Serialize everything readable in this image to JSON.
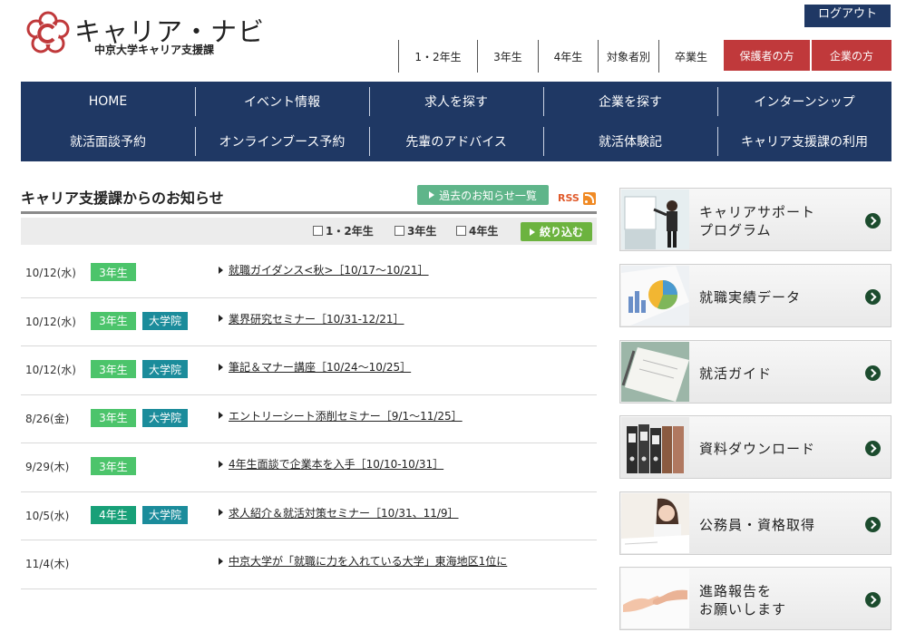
{
  "header": {
    "logo_title": "キャリア・ナビ",
    "logo_sub": "中京大学キャリア支援課",
    "logout_label": "ログアウト",
    "grade_nav": [
      "1・2年生",
      "3年生",
      "4年生",
      "対象者別",
      "卒業生"
    ],
    "role_buttons": [
      "保護者の方",
      "企業の方"
    ]
  },
  "mainnav": {
    "row1": [
      "HOME",
      "イベント情報",
      "求人を探す",
      "企業を探す",
      "インターンシップ"
    ],
    "row2": [
      "就活面談予約",
      "オンラインブース予約",
      "先輩のアドバイス",
      "就活体験記",
      "キャリア支援課の利用"
    ]
  },
  "news": {
    "title": "キャリア支援課からのお知らせ",
    "past_label": "過去のお知らせ一覧",
    "rss_label": "RSS",
    "filters": [
      "1・2年生",
      "3年生",
      "4年生"
    ],
    "filter_button": "絞り込む",
    "items": [
      {
        "date": "10/12(水)",
        "tags": [
          "3年生"
        ],
        "title": "就職ガイダンス<秋>［10/17〜10/21］"
      },
      {
        "date": "10/12(水)",
        "tags": [
          "3年生",
          "大学院"
        ],
        "title": "業界研究セミナー［10/31-12/21］"
      },
      {
        "date": "10/12(水)",
        "tags": [
          "3年生",
          "大学院"
        ],
        "title": "筆記＆マナー講座［10/24〜10/25］"
      },
      {
        "date": "8/26(金)",
        "tags": [
          "3年生",
          "大学院"
        ],
        "title": "エントリーシート添削セミナー［9/1〜11/25］"
      },
      {
        "date": "9/29(木)",
        "tags": [
          "3年生"
        ],
        "title": "4年生面談で企業本を入手［10/10-10/31］"
      },
      {
        "date": "10/5(水)",
        "tags": [
          "4年生",
          "大学院"
        ],
        "title": "求人紹介＆就活対策セミナー［10/31、11/9］"
      },
      {
        "date": "11/4(木)",
        "tags": [],
        "title": "中京大学が「就職に力を入れている大学」東海地区1位に"
      }
    ]
  },
  "sidebar": {
    "cards": [
      {
        "line1": "キャリアサポート",
        "line2": "プログラム"
      },
      {
        "line1": "就職実績データ",
        "line2": ""
      },
      {
        "line1": "就活ガイド",
        "line2": ""
      },
      {
        "line1": "資料ダウンロード",
        "line2": ""
      },
      {
        "line1": "公務員・資格取得",
        "line2": ""
      },
      {
        "line1": "進路報告を",
        "line2": "お願いします"
      }
    ]
  },
  "colors": {
    "navy": "#1f3864",
    "red": "#c0393b",
    "green_grade3": "#4cc46b",
    "green_grade4": "#18a078",
    "teal_grad": "#1b8c9b"
  }
}
